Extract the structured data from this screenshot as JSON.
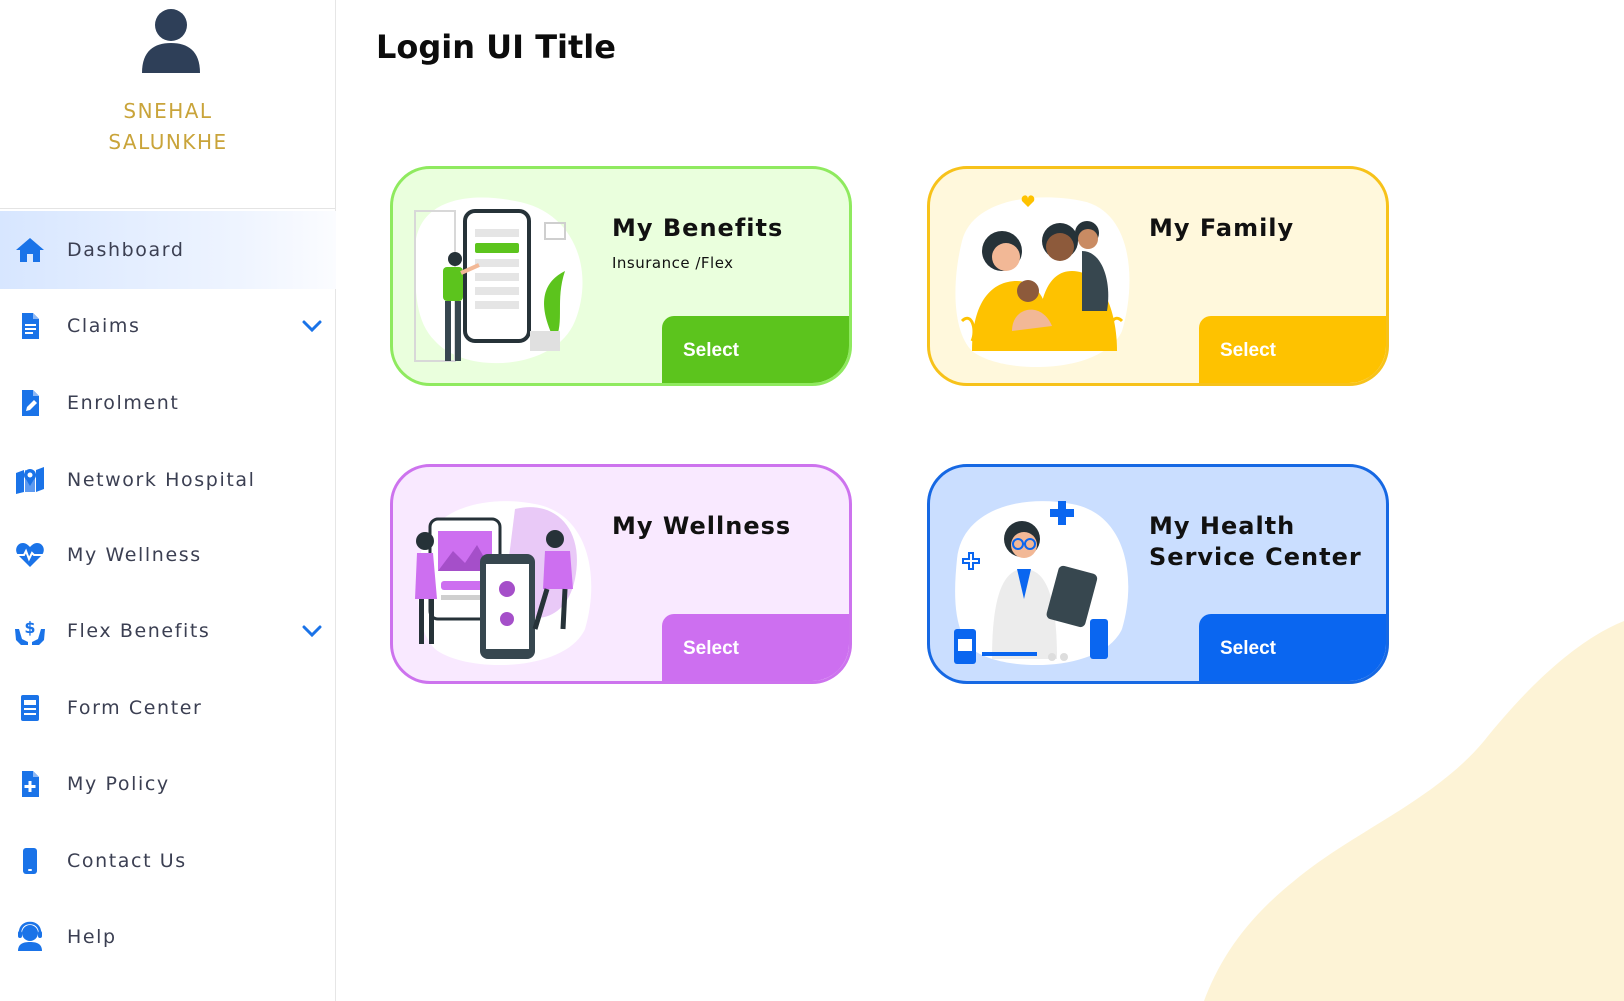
{
  "user": {
    "first_name": "SNEHAL",
    "last_name": "SALUNKHE"
  },
  "page": {
    "title": "Login UI Title"
  },
  "sidebar": {
    "items": [
      {
        "label": "Dashboard",
        "icon": "home-icon",
        "active": true
      },
      {
        "label": "Claims",
        "icon": "document-icon",
        "expandable": true
      },
      {
        "label": "Enrolment",
        "icon": "edit-document-icon"
      },
      {
        "label": "Network Hospital",
        "icon": "map-pin-icon"
      },
      {
        "label": "My Wellness",
        "icon": "heartbeat-icon"
      },
      {
        "label": "Flex Benefits",
        "icon": "hands-dollar-icon",
        "expandable": true
      },
      {
        "label": "Form Center",
        "icon": "form-icon"
      },
      {
        "label": "My Policy",
        "icon": "policy-plus-icon"
      },
      {
        "label": "Contact Us",
        "icon": "phone-icon"
      },
      {
        "label": "Help",
        "icon": "support-agent-icon"
      }
    ]
  },
  "cards": [
    {
      "title": "My Benefits",
      "subtitle": "Insurance /Flex",
      "button": "Select",
      "bg": "#eaffdd",
      "border": "#8fea5f",
      "accent": "#5cc41d",
      "illustration": "benefits-illustration"
    },
    {
      "title": "My Family",
      "subtitle": "",
      "button": "Select",
      "bg": "#fff8dc",
      "border": "#f7c21a",
      "accent": "#fec200",
      "illustration": "family-illustration"
    },
    {
      "title": "My Wellness",
      "subtitle": "",
      "button": "Select",
      "bg": "#f9e9ff",
      "border": "#cd73ee",
      "accent": "#cd6ff0",
      "illustration": "wellness-illustration"
    },
    {
      "title": "My Health Service Center",
      "subtitle": "",
      "button": "Select",
      "bg": "#cadeff",
      "border": "#1668e3",
      "accent": "#0a66f0",
      "illustration": "doctor-illustration"
    }
  ],
  "colors": {
    "nav_icon": "#1a73e8",
    "user_name": "#c9a43a",
    "blob": "#fdf3d6"
  }
}
